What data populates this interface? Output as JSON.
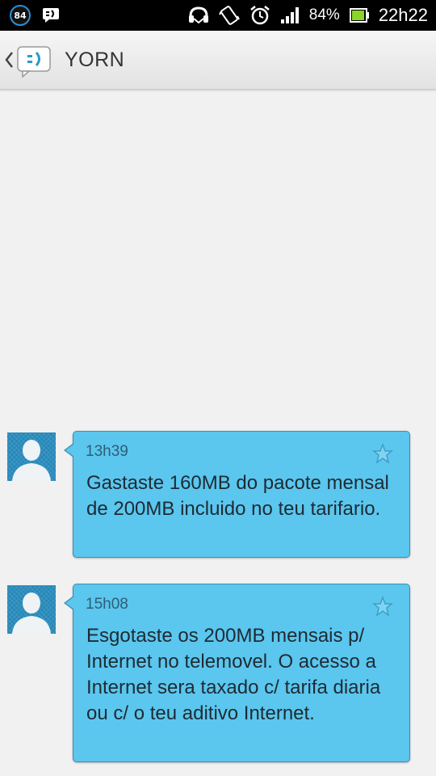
{
  "status_bar": {
    "notification_badge": "84",
    "battery_percent": "84%",
    "time": "22h22",
    "icons": [
      "notification-count-icon",
      "message-icon",
      "headset-icon",
      "vibrate-icon",
      "alarm-icon",
      "signal-icon",
      "battery-icon"
    ]
  },
  "header": {
    "title": "YORN",
    "icons": [
      "back-chevron-icon",
      "messaging-app-icon"
    ]
  },
  "messages": [
    {
      "time": "13h39",
      "text": "Gastaste 160MB do pacote mensal de 200MB incluido no teu tarifario."
    },
    {
      "time": "15h08",
      "text": "Esgotaste os 200MB mensais p/ Internet no telemovel. O acesso a Internet sera taxado c/ tarifa diaria ou c/ o teu aditivo Internet."
    }
  ],
  "colors": {
    "bubble": "#5bc6ee",
    "bubble_border": "#3a8fb3",
    "avatar": "#2a8fc1",
    "header": "#eeeeee",
    "background": "#f1f1f1"
  }
}
